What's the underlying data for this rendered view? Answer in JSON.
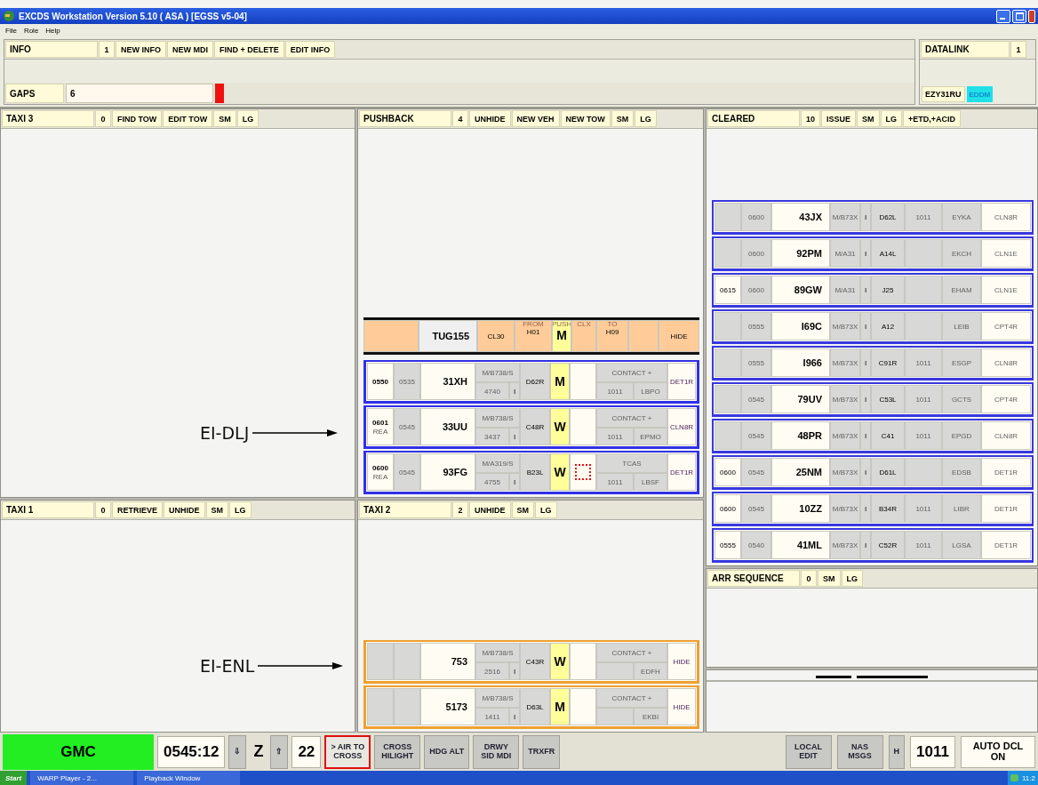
{
  "window": {
    "title": "EXCDS Workstation Version 5.10 ( ASA )  [EGSS v5-04]"
  },
  "menu": [
    "File",
    "Role",
    "Help"
  ],
  "info": {
    "title": "INFO",
    "count": "1",
    "buttons": [
      "NEW INFO",
      "NEW MDI",
      "FIND + DELETE",
      "EDIT INFO"
    ]
  },
  "gaps": {
    "label": "GAPS",
    "value": "6"
  },
  "datalink": {
    "title": "DATALINK",
    "count": "1",
    "callsign": "EZY31RU",
    "airport": "EDDM"
  },
  "taxi3": {
    "title": "TAXI 3",
    "count": "0",
    "buttons": [
      "FIND TOW",
      "EDIT TOW",
      "SM",
      "LG"
    ]
  },
  "taxi1": {
    "title": "TAXI 1",
    "count": "0",
    "buttons": [
      "RETRIEVE",
      "UNHIDE",
      "SM",
      "LG"
    ]
  },
  "pushback": {
    "title": "PUSHBACK",
    "count": "4",
    "buttons": [
      "UNHIDE",
      "NEW VEH",
      "NEW TOW",
      "SM",
      "LG"
    ],
    "strips": [
      {
        "kind": "tug",
        "callsign": "TUG155",
        "route": "CL30",
        "from_label": "FROM",
        "from": "H01",
        "push_label": "PUSH",
        "push": "M",
        "clx_label": "CLX",
        "to_label": "TO",
        "to": "H09",
        "action": "HIDE"
      },
      {
        "kind": "departure",
        "color": "#3030e8",
        "eobt": "0550",
        "ctot": "0535",
        "callsign": "31XH",
        "type": "M/B738/S",
        "squawk": "4740",
        "rules": "I",
        "runway": "D62R",
        "category": "M",
        "contact": "CONTACT +",
        "freq": "1011",
        "dest": "LBPO",
        "sid": "DET1R",
        "flagged": false
      },
      {
        "kind": "departure",
        "color": "#3030e8",
        "eobt": "0601",
        "eobt_note": "REA",
        "ctot": "0545",
        "callsign": "33UU",
        "type": "M/B738/S",
        "squawk": "3437",
        "rules": "I",
        "runway": "C48R",
        "category": "W",
        "contact": "CONTACT +",
        "freq": "1011",
        "dest": "EPMO",
        "sid": "CLN8R",
        "flagged": false
      },
      {
        "kind": "departure",
        "color": "#3030e8",
        "eobt": "0600",
        "eobt_note": "REA",
        "ctot": "0545",
        "callsign": "93FG",
        "type": "M/A319/S",
        "squawk": "4755",
        "rules": "I",
        "runway": "B23L",
        "category": "W",
        "contact": "TCAS",
        "freq": "1011",
        "dest": "LBSF",
        "sid": "DET1R",
        "flagged": true
      }
    ]
  },
  "taxi2": {
    "title": "TAXI 2",
    "count": "2",
    "buttons": [
      "UNHIDE",
      "SM",
      "LG"
    ],
    "strips": [
      {
        "kind": "departure",
        "color": "#f0a030",
        "callsign": "753",
        "type": "M/B738/S",
        "squawk": "2516",
        "rules": "I",
        "runway": "C43R",
        "category": "W",
        "contact": "CONTACT +",
        "dest": "EDFH",
        "sid": "HIDE",
        "flagged": false
      },
      {
        "kind": "departure",
        "color": "#f0a030",
        "callsign": "5173",
        "type": "M/B738/S",
        "squawk": "1411",
        "rules": "I",
        "runway": "D63L",
        "category": "M",
        "contact": "CONTACT +",
        "dest": "EKBI",
        "sid": "HIDE",
        "flagged": false
      }
    ]
  },
  "cleared": {
    "title": "CLEARED",
    "count": "10",
    "buttons": [
      "ISSUE",
      "SM",
      "LG",
      "+ETD,+ACID"
    ],
    "strips": [
      {
        "ctot": "0600",
        "callsign": "43JX",
        "type": "M/B73X",
        "rules": "I",
        "stand": "D62L",
        "squawk": "1011",
        "dest": "EYKA",
        "sid": "CLN8R"
      },
      {
        "ctot": "0600",
        "callsign": "92PM",
        "type": "M/A31",
        "rules": "I",
        "stand": "A14L",
        "dest": "EKCH",
        "sid": "CLN1E"
      },
      {
        "eobt": "0615",
        "ctot": "0600",
        "callsign": "89GW",
        "type": "M/A31",
        "rules": "I",
        "stand": "J25",
        "dest": "EHAM",
        "sid": "CLN1E"
      },
      {
        "ctot": "0555",
        "callsign": "I69C",
        "type": "M/B73X",
        "rules": "I",
        "stand": "A12",
        "dest": "LEIB",
        "sid": "CPT4R"
      },
      {
        "ctot": "0555",
        "callsign": "I966",
        "type": "M/B73X",
        "rules": "I",
        "stand": "C91R",
        "squawk": "1011",
        "dest": "ESGP",
        "sid": "CLN8R"
      },
      {
        "ctot": "0545",
        "callsign": "79UV",
        "type": "M/B73X",
        "rules": "I",
        "stand": "C53L",
        "squawk": "1011",
        "dest": "GCTS",
        "sid": "CPT4R"
      },
      {
        "ctot": "0545",
        "callsign": "48PR",
        "type": "M/B73X",
        "rules": "I",
        "stand": "C41",
        "squawk": "1011",
        "dest": "EPGD",
        "sid": "CLN8R"
      },
      {
        "eobt": "0600",
        "ctot": "0545",
        "callsign": "25NM",
        "type": "M/B73X",
        "rules": "I",
        "stand": "D61L",
        "dest": "EDSB",
        "sid": "DET1R"
      },
      {
        "eobt": "0600",
        "ctot": "0545",
        "callsign": "10ZZ",
        "type": "M/B73X",
        "rules": "I",
        "stand": "B34R",
        "squawk": "1011",
        "dest": "LIBR",
        "sid": "DET1R"
      },
      {
        "eobt": "0555",
        "ctot": "0540",
        "callsign": "41ML",
        "type": "M/B73X",
        "rules": "I",
        "stand": "C52R",
        "squawk": "1011",
        "dest": "LGSA",
        "sid": "DET1R"
      }
    ]
  },
  "arr_sequence": {
    "title": "ARR SEQUENCE",
    "count": "0",
    "buttons": [
      "SM",
      "LG"
    ]
  },
  "annotations": [
    {
      "label": "EI-DLJ"
    },
    {
      "label": "EI-ENL"
    }
  ],
  "bottom_bar": {
    "left": [
      {
        "kind": "status",
        "label": "GMC"
      },
      {
        "kind": "display",
        "label": "0545:12"
      },
      {
        "kind": "button",
        "label": "⇩"
      },
      {
        "kind": "plain",
        "label": "Z"
      },
      {
        "kind": "button",
        "label": "⇧"
      },
      {
        "kind": "display",
        "label": "22"
      },
      {
        "kind": "alert",
        "label": "> AIR TO CROSS"
      },
      {
        "kind": "button",
        "label": "CROSS HILIGHT"
      },
      {
        "kind": "button",
        "label": "HDG ALT"
      },
      {
        "kind": "button",
        "label": "DRWY SID MDI"
      },
      {
        "kind": "button",
        "label": "TRXFR"
      }
    ],
    "right": [
      {
        "kind": "button",
        "label": "LOCAL EDIT"
      },
      {
        "kind": "button",
        "label": "NAS MSGS"
      },
      {
        "kind": "button",
        "label": "H"
      },
      {
        "kind": "display",
        "label": "1011"
      },
      {
        "kind": "notice",
        "label": "AUTO DCL ON"
      }
    ]
  },
  "taskbar": {
    "start": "Start",
    "tasks": [
      "WARP Player - 2...",
      "Playback Window"
    ],
    "clock": "11:2"
  }
}
